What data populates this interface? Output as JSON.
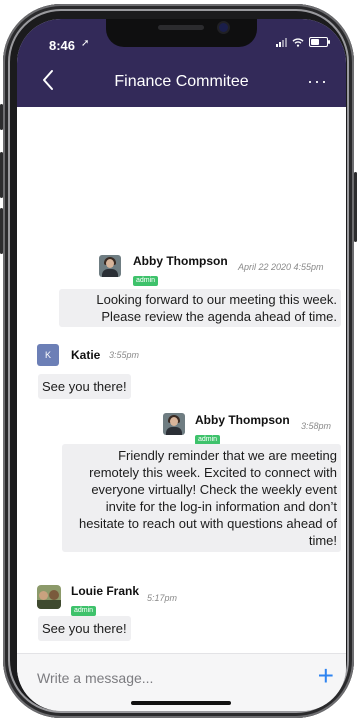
{
  "status_bar": {
    "time": "8:46"
  },
  "header": {
    "title": "Finance Commitee",
    "more_label": "···"
  },
  "messages": [
    {
      "sender": "Abby Thompson",
      "badge": "admin",
      "timestamp": "April 22 2020 4:55pm",
      "text": "Looking forward to our meeting this week. Please review the agenda ahead of time."
    },
    {
      "sender": "Katie",
      "avatar_letter": "K",
      "timestamp": "3:55pm",
      "text": "See you there!"
    },
    {
      "sender": "Abby Thompson",
      "badge": "admin",
      "timestamp": "3:58pm",
      "text": "Friendly reminder that we are meeting remotely this week. Excited to connect with everyone virtually! Check the weekly event invite for the log-in information and don’t hesitate to reach out with questions ahead of time!"
    },
    {
      "sender": "Louie Frank",
      "badge": "admin",
      "timestamp": "5:17pm",
      "text": "See you there!"
    }
  ],
  "composer": {
    "placeholder": "Write a message...",
    "add_label": "+"
  },
  "colors": {
    "header_bg": "#332a59",
    "admin_badge": "#3ec26b",
    "accent": "#2f84f0"
  }
}
